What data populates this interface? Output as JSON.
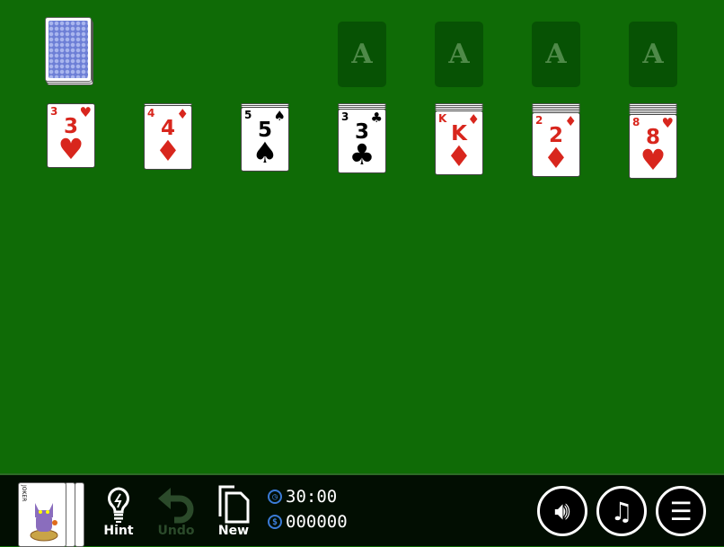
{
  "foundations": [
    {
      "label": "A"
    },
    {
      "label": "A"
    },
    {
      "label": "A"
    },
    {
      "label": "A"
    }
  ],
  "tableau": [
    {
      "hidden": 0,
      "rank": "3",
      "suit": "♥",
      "color": "red"
    },
    {
      "hidden": 1,
      "rank": "4",
      "suit": "♦",
      "color": "red"
    },
    {
      "hidden": 2,
      "rank": "5",
      "suit": "♠",
      "color": "black"
    },
    {
      "hidden": 3,
      "rank": "3",
      "suit": "♣",
      "color": "black"
    },
    {
      "hidden": 4,
      "rank": "K",
      "suit": "♦",
      "color": "red"
    },
    {
      "hidden": 5,
      "rank": "2",
      "suit": "♦",
      "color": "red"
    },
    {
      "hidden": 6,
      "rank": "8",
      "suit": "♥",
      "color": "red"
    }
  ],
  "toolbar": {
    "hint": "Hint",
    "undo": "Undo",
    "new": "New",
    "timer": "30:00",
    "score": "000000",
    "joker": "JOKER",
    "undo_enabled": false
  },
  "colors": {
    "felt": "#0f6b06",
    "red": "#d8261d"
  }
}
